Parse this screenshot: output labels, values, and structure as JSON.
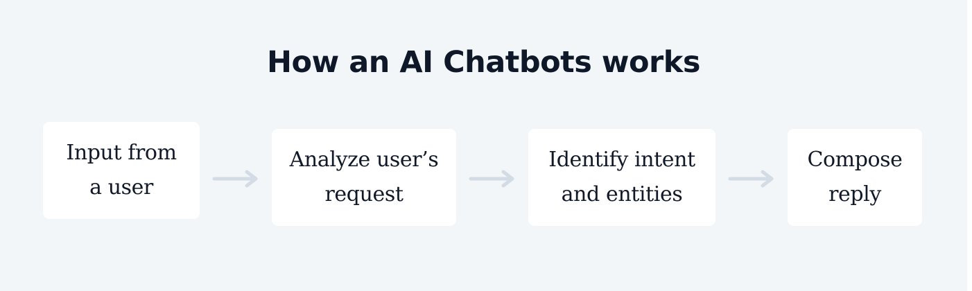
{
  "diagram": {
    "title": "How an AI Chatbots works",
    "steps": [
      {
        "line1": "Input from",
        "line2": "a user"
      },
      {
        "line1": "Analyze user’s",
        "line2": "request"
      },
      {
        "line1": "Identify intent",
        "line2": "and entities"
      },
      {
        "line1": "Compose",
        "line2": "reply"
      }
    ]
  },
  "colors": {
    "background": "#f3f6f9",
    "card": "#ffffff",
    "title_text": "#0f1828",
    "step_text": "#111827",
    "arrow": "#d3dbe4"
  },
  "icons": {
    "connector": "arrow-right-icon"
  }
}
